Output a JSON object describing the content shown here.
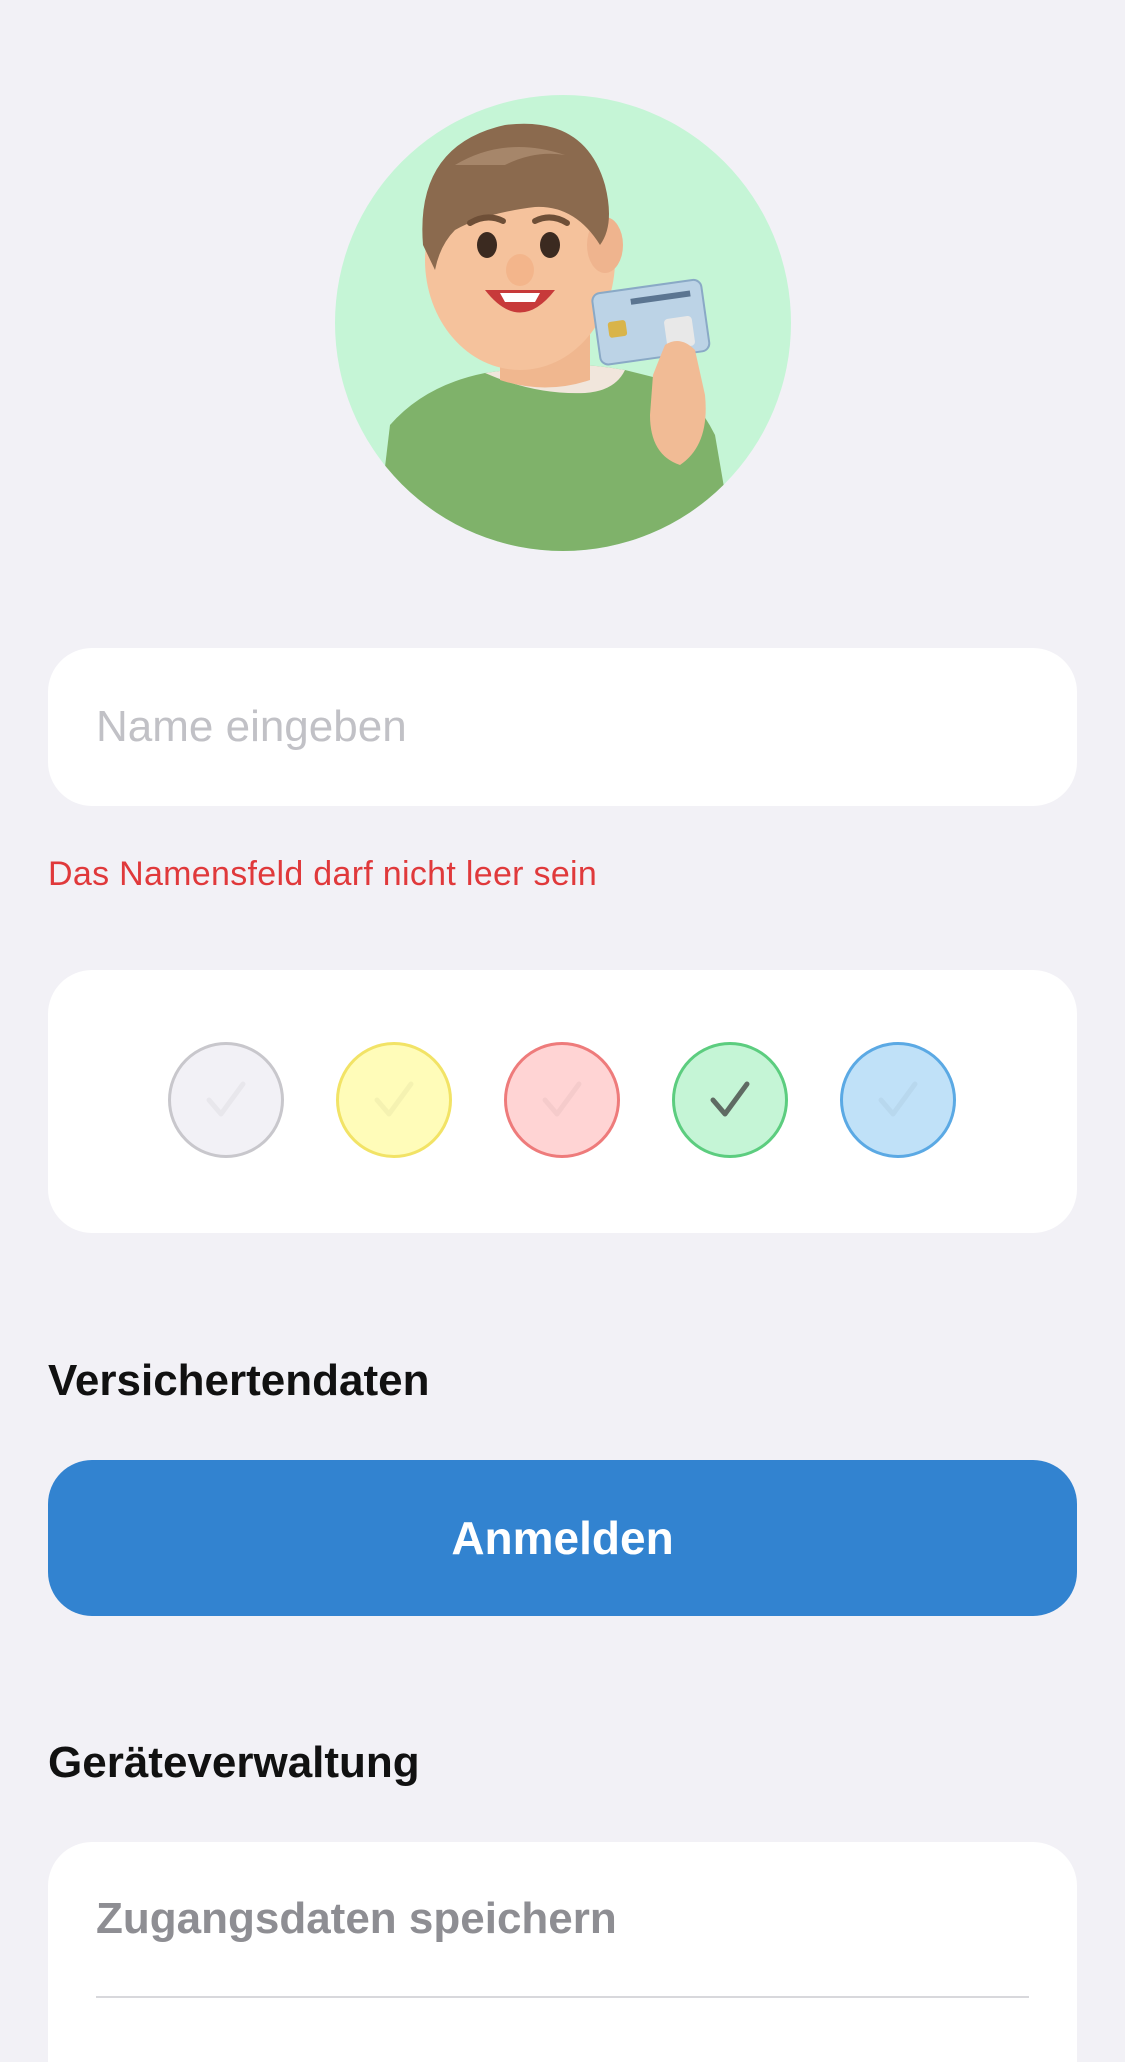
{
  "profile": {
    "avatar": "person-holding-health-insurance-card"
  },
  "name_field": {
    "placeholder": "Name eingeben",
    "value": ""
  },
  "error_message": "Das Namensfeld darf nicht leer sein",
  "color_picker": {
    "selected_index": 3,
    "options": [
      {
        "name": "gray",
        "fill": "#f2f1f6",
        "border": "#c8c7cc"
      },
      {
        "name": "yellow",
        "fill": "#fffcb9",
        "border": "#f2e366"
      },
      {
        "name": "red",
        "fill": "#ffd4d4",
        "border": "#ee7b7b"
      },
      {
        "name": "green",
        "fill": "#c5f5d6",
        "border": "#5ccd7f"
      },
      {
        "name": "blue",
        "fill": "#c0e1f8",
        "border": "#5ba9e4"
      }
    ]
  },
  "insurance_section": {
    "title": "Versichertendaten",
    "login_label": "Anmelden"
  },
  "device_section": {
    "title": "Geräteverwaltung",
    "save_credentials_label": "Zugangsdaten speichern"
  }
}
